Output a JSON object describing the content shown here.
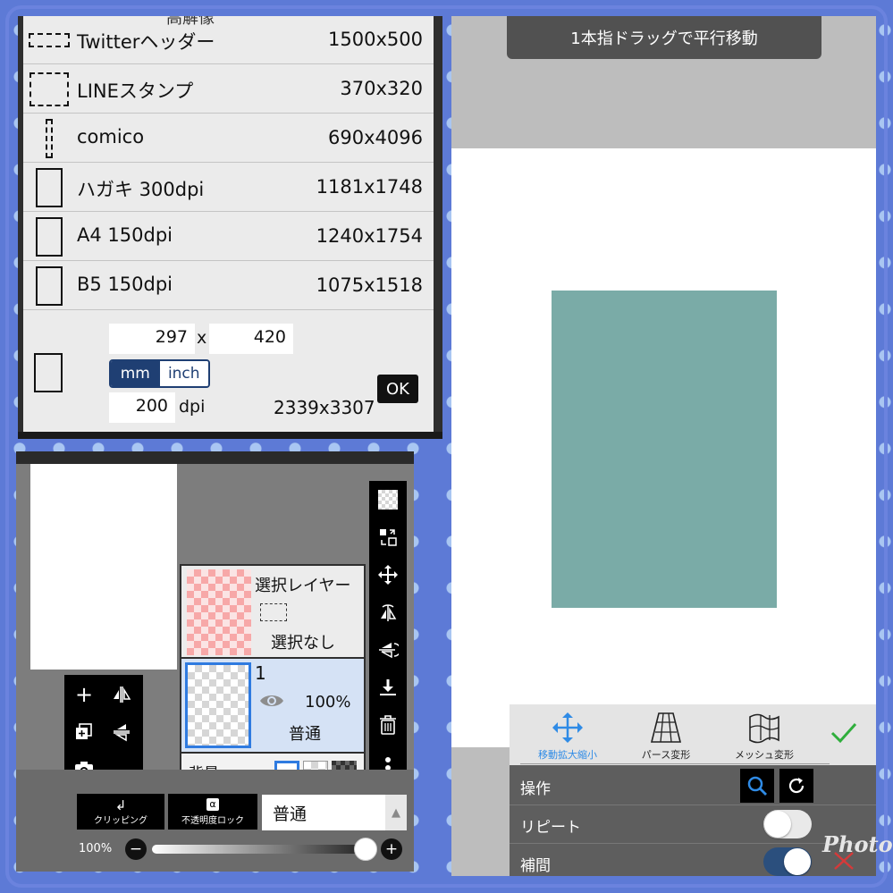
{
  "size_list": {
    "header_cut": "高解像",
    "presets": [
      {
        "name": "Twitterヘッダー",
        "dims": "1500x500",
        "icon": "dashed-wide-rect-icon"
      },
      {
        "name": "LINEスタンプ",
        "dims": "370x320",
        "icon": "dashed-square-icon"
      },
      {
        "name": "comico",
        "dims": "690x4096",
        "icon": "dashed-tall-rect-icon"
      },
      {
        "name": "ハガキ 300dpi",
        "dims": "1181x1748",
        "icon": "portrait-rect-icon"
      },
      {
        "name": "A4 150dpi",
        "dims": "1240x1754",
        "icon": "portrait-rect-icon"
      },
      {
        "name": "B5 150dpi",
        "dims": "1075x1518",
        "icon": "portrait-rect-icon"
      }
    ],
    "custom": {
      "width": "297",
      "x_label": "x",
      "height": "420",
      "unit_mm": "mm",
      "unit_inch": "inch",
      "dpi_value": "200",
      "dpi_label": "dpi",
      "pixel_result": "2339x3307",
      "ok_label": "OK"
    }
  },
  "layers": {
    "selection_layer_title": "選択レイヤー",
    "selection_none": "選択なし",
    "layer1_number": "1",
    "layer1_opacity": "100%",
    "layer1_blend": "普通",
    "background_label": "背景",
    "clipping_label": "クリッピング",
    "lock_alpha_label": "不透明度ロック",
    "blend_mode": "普通",
    "opacity_label": "100%",
    "opacity_value": 1.0
  },
  "transform": {
    "toast": "1本指ドラッグで平行移動",
    "tabs": [
      {
        "label": "移動拡大縮小",
        "active": true
      },
      {
        "label": "パース変形",
        "active": false
      },
      {
        "label": "メッシュ変形",
        "active": false
      }
    ],
    "operation_label": "操作",
    "repeat_label": "リピート",
    "repeat_on": false,
    "interpolate_label": "補間",
    "interpolate_on": true,
    "canvas_color": "#7aaba7"
  },
  "watermark": "Photo"
}
